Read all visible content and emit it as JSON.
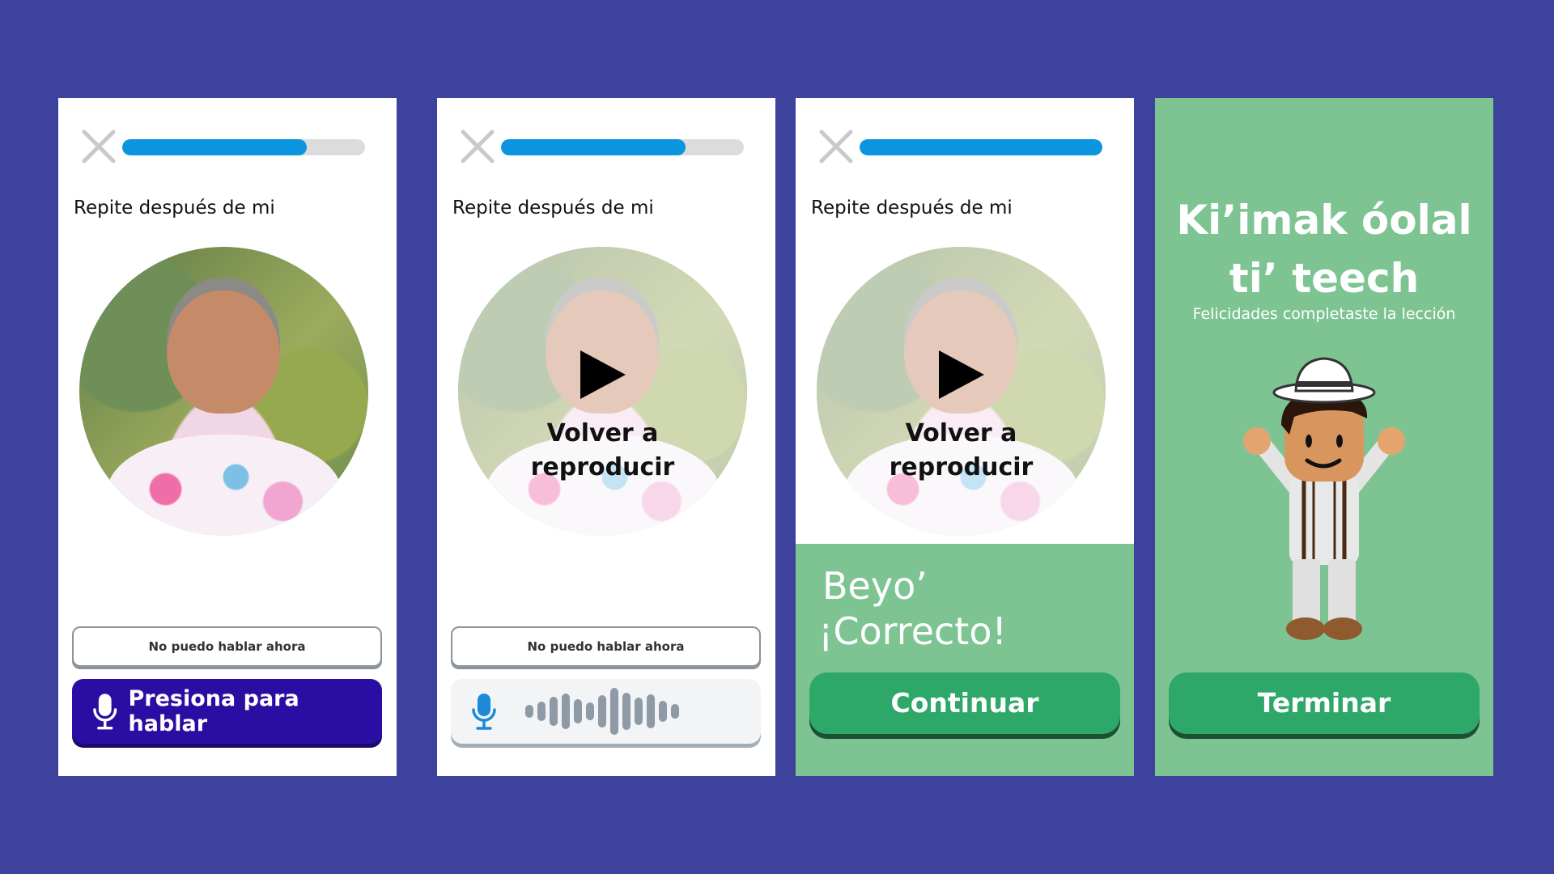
{
  "colors": {
    "background": "#3D439C",
    "progress_fill": "#0B95DE",
    "primary_button": "#2A0EA3",
    "success_green": "#7DC492",
    "action_green": "#2DA868"
  },
  "screens": [
    {
      "id": "speak",
      "progress_fraction": 0.76,
      "prompt": "Repite después de mi",
      "secondary_button": "No puedo hablar ahora",
      "primary_button": "Presiona para hablar",
      "icons": [
        "close-icon",
        "microphone-icon"
      ]
    },
    {
      "id": "recording",
      "progress_fraction": 0.76,
      "prompt": "Repite después de mi",
      "replay_label": "Volver a reproducir",
      "secondary_button": "No puedo hablar ahora",
      "icons": [
        "close-icon",
        "play-icon",
        "microphone-icon",
        "waveform-icon"
      ]
    },
    {
      "id": "correct",
      "progress_fraction": 1.0,
      "prompt": "Repite después de mi",
      "replay_label": "Volver a reproducir",
      "feedback_word": "Beyo’",
      "feedback_result": "¡Correcto!",
      "continue_button": "Continuar",
      "icons": [
        "close-icon",
        "play-icon"
      ]
    },
    {
      "id": "complete",
      "title_line1": "Ki’imak óolal",
      "title_line2": "ti’ teech",
      "subtitle": "Felicidades completaste la lección",
      "finish_button": "Terminar",
      "icons": [
        "mascot-illustration"
      ]
    }
  ]
}
